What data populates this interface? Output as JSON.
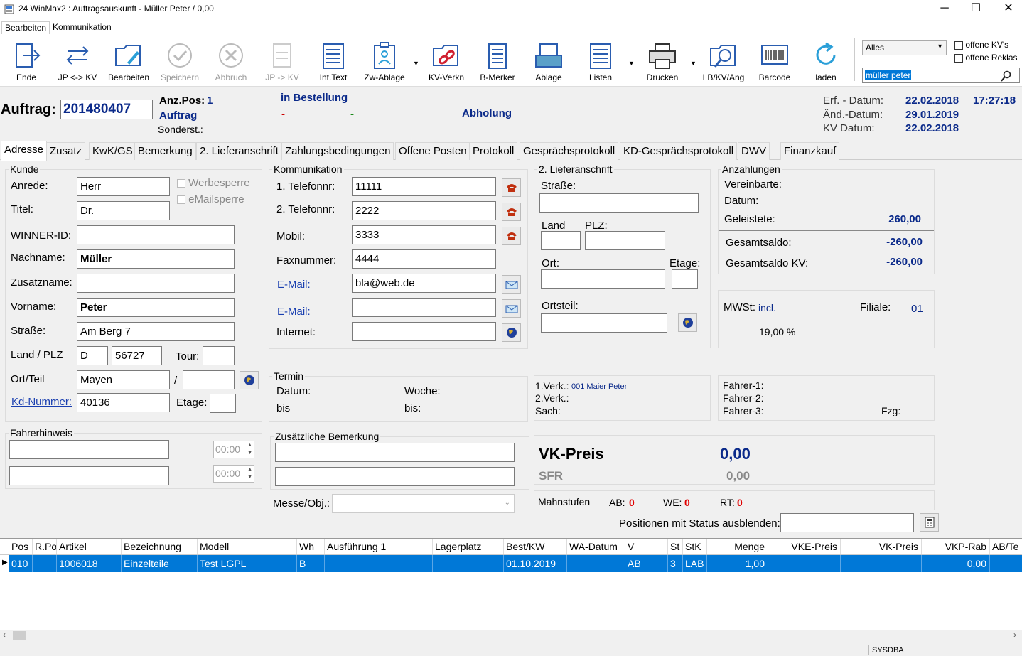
{
  "window": {
    "title": "24 WinMax2 : Auftragsauskunft - Müller Peter / 0,00"
  },
  "menu": [
    "Bearbeiten",
    "Kommunikation"
  ],
  "toolbar": {
    "items": [
      "Ende",
      "JP <-> KV",
      "Bearbeiten",
      "Speichern",
      "Abbruch",
      "JP -> KV",
      "Int.Text",
      "Zw-Ablage",
      "KV-Verkn",
      "B-Merker",
      "Ablage",
      "Listen",
      "Drucken",
      "LB/KV/Ang",
      "Barcode",
      "laden"
    ],
    "filter": "Alles",
    "cb1": "offene KV's",
    "cb2": "offene Reklas",
    "search": "müller peter"
  },
  "header": {
    "auftrag_label": "Auftrag:",
    "auftrag_nr": "201480407",
    "anzpos_label": "Anz.Pos:",
    "anzpos": "1",
    "auftrag_type": "Auftrag",
    "sonderst": "Sonderst.:",
    "in_bestellung": "in Bestellung",
    "dash1": "-",
    "dash2": "-",
    "abholung": "Abholung",
    "erf_label": "Erf. - Datum:",
    "erf_date": "22.02.2018",
    "erf_time": "17:27:18",
    "aend_label": "Änd.-Datum:",
    "aend_date": "29.01.2019",
    "kv_label": "KV Datum:",
    "kv_date": "22.02.2018"
  },
  "tabs": [
    "Adresse",
    "Zusatz",
    "KwK/GS",
    "Bemerkung",
    "2. Lieferanschrift",
    "Zahlungsbedingungen",
    "Offene Posten",
    "Protokoll",
    "Gesprächsprotokoll",
    "KD-Gesprächsprotokoll",
    "DWV",
    "Finanzkauf"
  ],
  "kunde": {
    "title": "Kunde",
    "anrede_l": "Anrede:",
    "anrede": "Herr",
    "titel_l": "Titel:",
    "titel": "Dr.",
    "werbesperre": "Werbesperre",
    "emailsperre": "eMailsperre",
    "winner_l": "WINNER-ID:",
    "winner": "",
    "nachname_l": "Nachname:",
    "nachname": "Müller",
    "zusatz_l": "Zusatzname:",
    "zusatz": "",
    "vorname_l": "Vorname:",
    "vorname": "Peter",
    "strasse_l": "Straße:",
    "strasse": "Am Berg 7",
    "landplz_l": "Land / PLZ",
    "land": "D",
    "plz": "56727",
    "tour_l": "Tour:",
    "ortteil_l": "Ort/Teil",
    "ort": "Mayen",
    "slash": "/",
    "kdnr_l": "Kd-Nummer:",
    "kdnr": "40136",
    "etage_l": "Etage:"
  },
  "komm": {
    "title": "Kommunikation",
    "tel1_l": "1. Telefonnr:",
    "tel1": "11111",
    "tel2_l": "2. Telefonnr:",
    "tel2": "2222",
    "mobil_l": "Mobil:",
    "mobil": "3333",
    "fax_l": "Faxnummer:",
    "fax": "4444",
    "email_l": "E-Mail:",
    "email": "bla@web.de",
    "email2_l": "E-Mail:",
    "email2": "",
    "internet_l": "Internet:"
  },
  "liefer": {
    "title": "2. Lieferanschrift",
    "strasse_l": "Straße:",
    "land_l": "Land",
    "plz_l": "PLZ:",
    "ort_l": "Ort:",
    "etage_l": "Etage:",
    "ortsteil_l": "Ortsteil:"
  },
  "anz": {
    "title": "Anzahlungen",
    "vereinbarte": "Vereinbarte:",
    "datum": "Datum:",
    "geleistete_l": "Geleistete:",
    "geleistete": "260,00",
    "gesamt_l": "Gesamtsaldo:",
    "gesamt": "-260,00",
    "gesamtkv_l": "Gesamtsaldo KV:",
    "gesamtkv": "-260,00"
  },
  "mwst": {
    "label": "MWSt:",
    "value": "incl.",
    "filiale_l": "Filiale:",
    "filiale": "01",
    "rate": "19,00 %"
  },
  "termin": {
    "title": "Termin",
    "datum": "Datum:",
    "woche": "Woche:",
    "bis1": "bis",
    "bis2": "bis:"
  },
  "verk": {
    "v1": "1.Verk.:",
    "v1val": "001 Maier Peter",
    "v2": "2.Verk.:",
    "sach": "Sach:"
  },
  "fahrer": {
    "f1": "Fahrer-1:",
    "f2": "Fahrer-2:",
    "f3": "Fahrer-3:",
    "fzg": "Fzg:"
  },
  "fahrerhinweis": {
    "title": "Fahrerhinweis",
    "t1": "00:00",
    "t2": "00:00"
  },
  "bemerkung": {
    "title": "Zusätzliche Bemerkung"
  },
  "preis": {
    "vk_l": "VK-Preis",
    "vk": "0,00",
    "sfr_l": "SFR",
    "sfr": "0,00"
  },
  "mahn": {
    "label": "Mahnstufen",
    "ab_l": "AB:",
    "ab": "0",
    "we_l": "WE:",
    "we": "0",
    "rt_l": "RT:",
    "rt": "0"
  },
  "messe": {
    "label": "Messe/Obj.:"
  },
  "positionen": {
    "label": "Positionen mit Status ausblenden:"
  },
  "grid": {
    "headers": [
      "Pos",
      "R.Po",
      "Artikel",
      "Bezeichnung",
      "Modell",
      "Wh",
      "Ausführung 1",
      "Lagerplatz",
      "Best/KW",
      "WA-Datum",
      "V",
      "St",
      "StK",
      "Menge",
      "VKE-Preis",
      "VK-Preis",
      "VKP-Rab",
      "AB/Te"
    ],
    "row": [
      "010",
      "",
      "1006018",
      "Einzelteile",
      "Test LGPL",
      "B",
      "",
      "",
      "01.10.2019",
      "",
      "AB",
      "3",
      "LAB",
      "1,00",
      "",
      "",
      "0,00",
      ""
    ]
  },
  "status": {
    "user": "SYSDBA"
  },
  "colors": {
    "selection": "#0078d7",
    "navy": "#0b2a8a",
    "red": "#e00000"
  }
}
